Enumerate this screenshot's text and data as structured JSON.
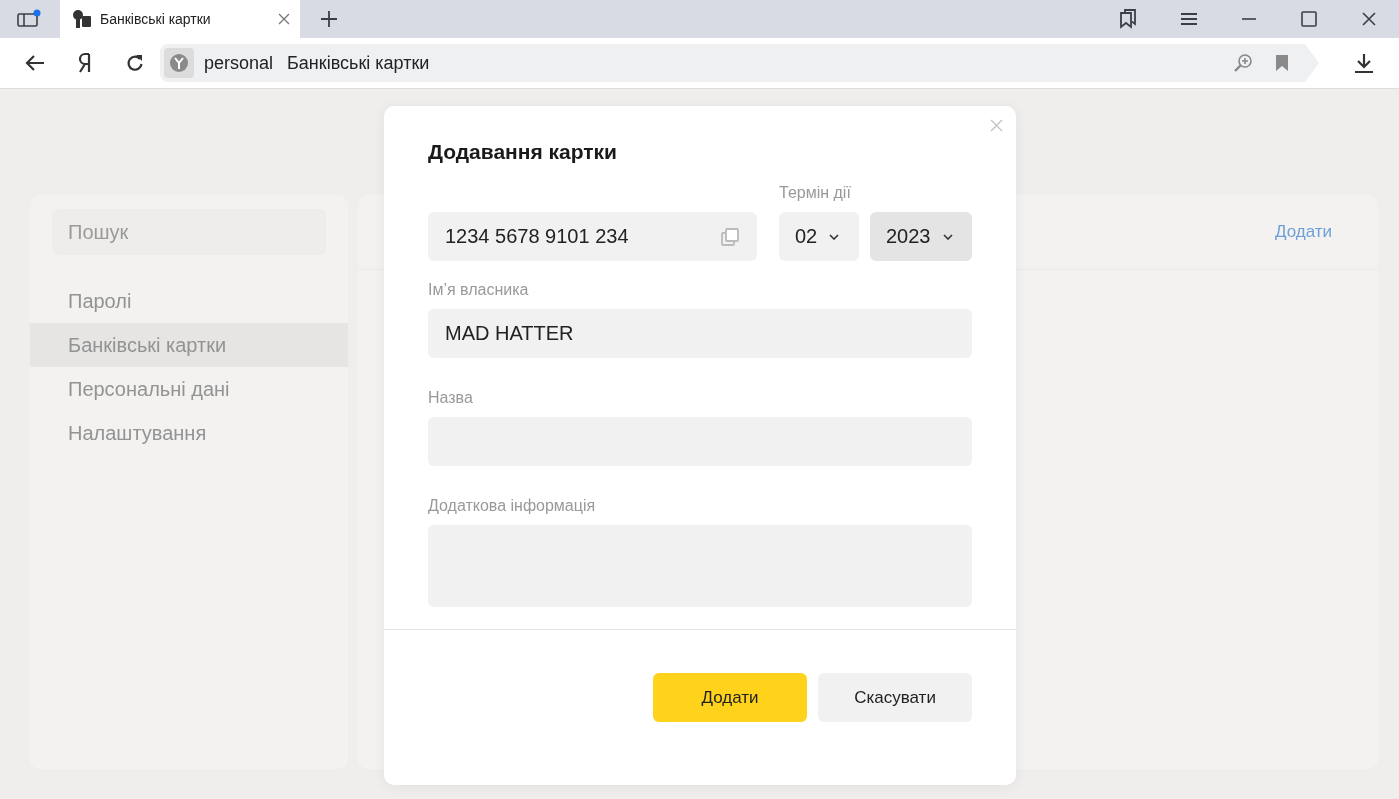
{
  "tabs": [
    {
      "title": "Банківські картки",
      "selected": true
    }
  ],
  "address_bar": {
    "host": "personal",
    "page": "Банківські картки"
  },
  "sidebar": {
    "search": {
      "placeholder": "Пошук"
    },
    "items": [
      {
        "label": "Паролі",
        "selected": false
      },
      {
        "label": "Банківські картки",
        "selected": true
      },
      {
        "label": "Персональні дані",
        "selected": false
      },
      {
        "label": "Налаштування",
        "selected": false
      }
    ]
  },
  "main": {
    "add_link": "Додати"
  },
  "dialog": {
    "title": "Додавання картки",
    "card_number": {
      "value": "1234 5678 9101 234"
    },
    "expiry": {
      "label": "Термін дії",
      "month": {
        "value": "02",
        "hover": false
      },
      "year": {
        "value": "2023",
        "hover": true
      }
    },
    "owner": {
      "label": "Ім’я власника",
      "value": "MAD HATTER"
    },
    "name": {
      "label": "Назва"
    },
    "notes": {
      "label": "Додаткова інформація"
    },
    "buttons": [
      {
        "label": "Додати",
        "kind": "primary"
      },
      {
        "label": "Скасувати",
        "kind": "secondary"
      }
    ]
  }
}
